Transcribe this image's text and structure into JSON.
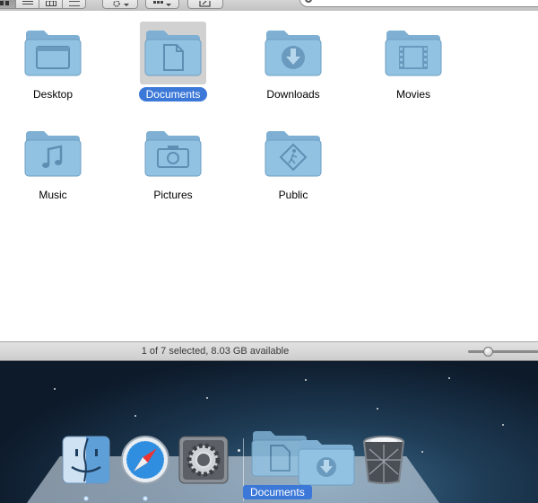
{
  "toolbar": {
    "view_modes": [
      "icon-view",
      "list-view",
      "column-view",
      "coverflow-view"
    ],
    "active_view": "icon-view",
    "action_menu": "gear-icon",
    "arrange_menu": "grid-icon",
    "share_button": "share-icon",
    "search_icon": "search-icon"
  },
  "files": [
    {
      "name": "Desktop",
      "icon": "desktop-folder-icon",
      "selected": false
    },
    {
      "name": "Documents",
      "icon": "documents-folder-icon",
      "selected": true
    },
    {
      "name": "Downloads",
      "icon": "downloads-folder-icon",
      "selected": false
    },
    {
      "name": "Movies",
      "icon": "movies-folder-icon",
      "selected": false
    },
    {
      "name": "Music",
      "icon": "music-folder-icon",
      "selected": false
    },
    {
      "name": "Pictures",
      "icon": "pictures-folder-icon",
      "selected": false
    },
    {
      "name": "Public",
      "icon": "public-folder-icon",
      "selected": false
    }
  ],
  "status": {
    "text": "1 of 7 selected, 8.03 GB available",
    "icon_size_level": 0.25
  },
  "dock": {
    "apps": [
      {
        "name": "Finder",
        "icon": "finder-icon",
        "running": true
      },
      {
        "name": "Safari",
        "icon": "safari-icon",
        "running": true
      },
      {
        "name": "System Preferences",
        "icon": "system-preferences-icon",
        "running": false
      }
    ],
    "stack": {
      "name": "Documents",
      "icon": "documents-stack-icon"
    },
    "trash": {
      "name": "Trash",
      "icon": "trash-icon"
    }
  },
  "colors": {
    "selection": "#3c78d8",
    "folder": "#8fc0e0"
  }
}
